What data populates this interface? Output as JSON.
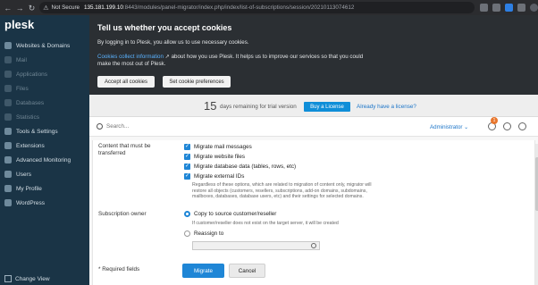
{
  "browser": {
    "security": "Not Secure",
    "host": "135.181.199.10",
    "path": ":8443/modules/panel-migrator/index.php/index/list-of-subscriptions/session/20210113074612",
    "back": "←",
    "forward": "→",
    "reload": "↻",
    "warn": "⚠"
  },
  "sidebar": {
    "logo": "plesk",
    "items": [
      {
        "label": "Websites & Domains",
        "dim": false
      },
      {
        "label": "Mail",
        "dim": true
      },
      {
        "label": "Applications",
        "dim": true
      },
      {
        "label": "Files",
        "dim": true
      },
      {
        "label": "Databases",
        "dim": true
      },
      {
        "label": "Statistics",
        "dim": true
      },
      {
        "label": "Tools & Settings",
        "dim": false
      },
      {
        "label": "Extensions",
        "dim": false
      },
      {
        "label": "Advanced Monitoring",
        "dim": false
      },
      {
        "label": "Users",
        "dim": false
      },
      {
        "label": "My Profile",
        "dim": false
      },
      {
        "label": "WordPress",
        "dim": false
      }
    ],
    "change_view": "Change View"
  },
  "cookie": {
    "title": "Tell us whether you accept cookies",
    "line1": "By logging in to Plesk, you allow us to use necessary cookies.",
    "link": "Cookies collect information",
    "line2": " about how you use Plesk. It helps us to improve our services so that you could make the most out of Plesk.",
    "accept_label": "Accept all cookies",
    "prefs_label": "Set cookie preferences"
  },
  "trial": {
    "days": "15",
    "text": "days remaining for trial version",
    "buy_label": "Buy a License",
    "have_license": "Already have a license?"
  },
  "topbar": {
    "search_placeholder": "Search...",
    "admin": "Administrator ⌄",
    "notif_count": "1"
  },
  "form": {
    "content_label": "Content that must be transferred",
    "options": [
      "Migrate mail messages",
      "Migrate website files",
      "Migrate database data (tables, rows, etc)",
      "Migrate external IDs"
    ],
    "external_hint": "Regardless of these options, which are related to migration of content only, migrator will restore all objects (customers, resellers, subscriptions, add-on domains, subdomains, mailboxes, databases, database users, etc) and their settings for selected domains.",
    "owner_label": "Subscription owner",
    "owner_opt1": "Copy to source customer/reseller",
    "owner_hint": "If customer/reseller does not exist on the target server, it will be created",
    "owner_opt2": "Reassign to",
    "required": "* Required fields",
    "migrate_label": "Migrate",
    "cancel_label": "Cancel"
  },
  "colors": {
    "sidebar_bg": "#1a3446",
    "accent": "#1f86d6",
    "cookie_bg": "#2b2f33"
  }
}
